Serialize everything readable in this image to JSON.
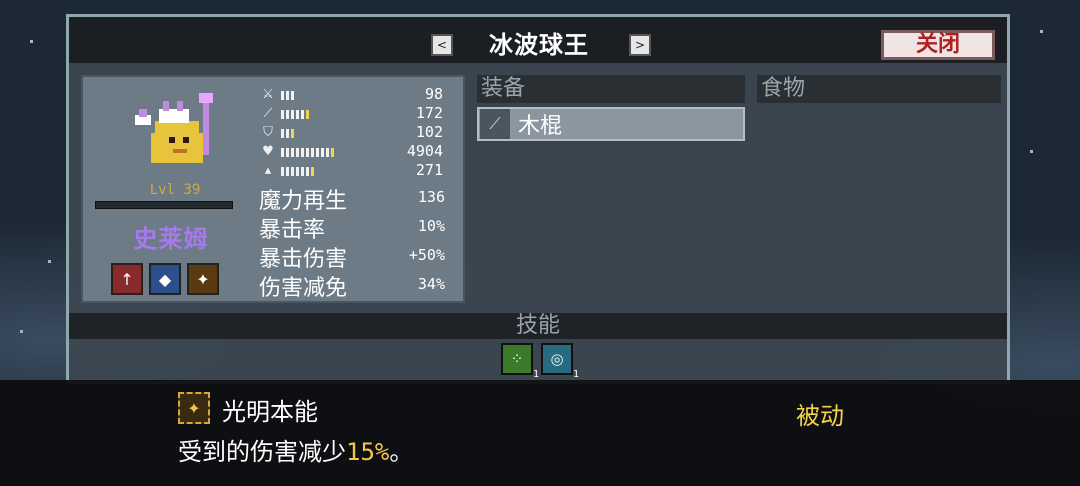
{
  "window": {
    "title": "冰波球王",
    "prev_label": "<",
    "next_label": ">",
    "close_label": "关闭"
  },
  "character": {
    "level": "Lvl 39",
    "name": "史莱姆",
    "stats": [
      {
        "icon": "sword-icon",
        "value": "98",
        "pips": 3,
        "yellow": 0
      },
      {
        "icon": "staff-icon",
        "value": "172",
        "pips": 6,
        "yellow": 1
      },
      {
        "icon": "shield-icon",
        "value": "102",
        "pips": 3,
        "yellow": 1
      },
      {
        "icon": "heart-icon",
        "value": "4904",
        "pips": 11,
        "yellow": 1
      },
      {
        "icon": "boot-icon",
        "value": "271",
        "pips": 7,
        "yellow": 1
      }
    ],
    "attributes": [
      {
        "label": "魔力再生",
        "value": "136"
      },
      {
        "label": "暴击率",
        "value": "10%"
      },
      {
        "label": "暴击伤害",
        "value": "+50%"
      },
      {
        "label": "伤害减免",
        "value": "34%"
      }
    ],
    "badges": [
      {
        "name": "attack-up-badge",
        "glyph": "↑",
        "color": "#8a2a2a"
      },
      {
        "name": "water-badge",
        "glyph": "◆",
        "color": "#2d4f8e"
      },
      {
        "name": "light-badge",
        "glyph": "✦",
        "color": "#5a3a10"
      }
    ]
  },
  "equipment": {
    "header": "装备",
    "items": [
      {
        "name": "木棍",
        "icon": "stick-icon"
      }
    ]
  },
  "food": {
    "header": "食物"
  },
  "skills": {
    "header": "技能",
    "slots": [
      {
        "name": "skill-slot-1",
        "glyph": "⁘",
        "color": "#3a7a2a",
        "count": "1"
      },
      {
        "name": "skill-slot-2",
        "glyph": "◎",
        "color": "#2a6a80",
        "count": "1"
      }
    ]
  },
  "tooltip": {
    "skill_name": "光明本能",
    "skill_type": "被动",
    "desc_prefix": "受到的伤害减少",
    "desc_highlight": "15%",
    "desc_suffix": "。"
  },
  "colors": {
    "accent_gold": "#d7a93a",
    "name_purple": "#a779ee",
    "close_red": "#b02020",
    "highlight_yellow": "#f2d34a"
  }
}
